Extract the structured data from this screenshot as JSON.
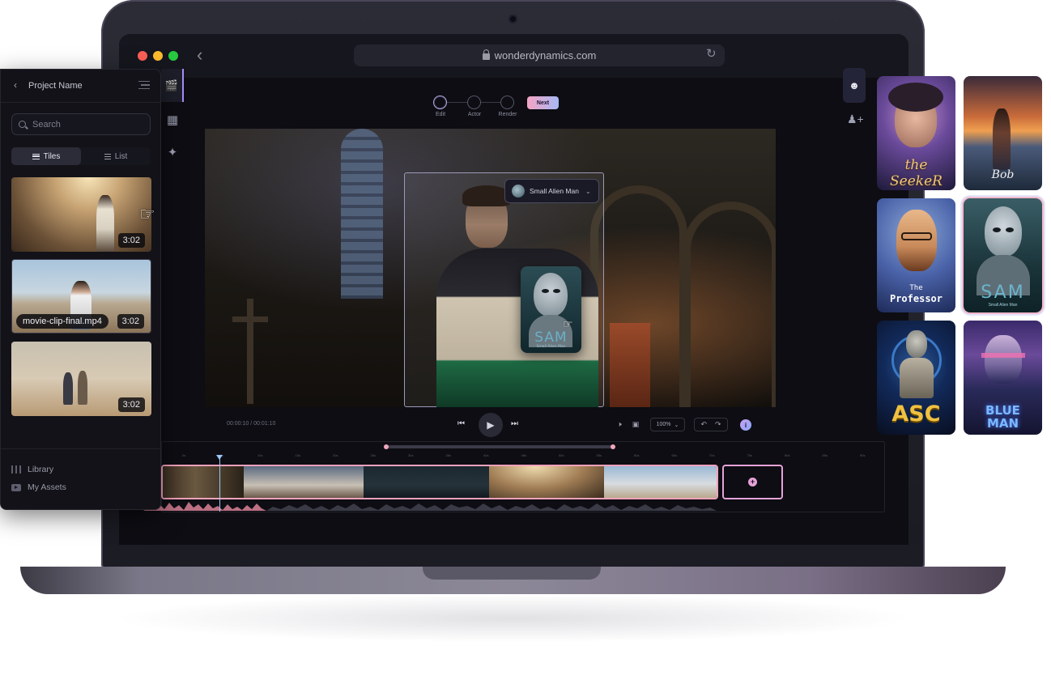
{
  "browser": {
    "url": "wonderdynamics.com"
  },
  "project_panel": {
    "title": "Project Name",
    "search_placeholder": "Search",
    "view_tabs": [
      {
        "label": "Tiles",
        "active": true
      },
      {
        "label": "List",
        "active": false
      }
    ],
    "clips": [
      {
        "duration": "3:02"
      },
      {
        "duration": "3:02",
        "filename": "movie-clip-final.mp4"
      },
      {
        "duration": "3:02"
      }
    ],
    "nav": [
      {
        "label": "Library",
        "icon": "library-icon"
      },
      {
        "label": "My Assets",
        "icon": "assets-icon"
      }
    ]
  },
  "stepper": {
    "steps": [
      {
        "label": "Edit",
        "active": true
      },
      {
        "label": "Actor",
        "active": false
      },
      {
        "label": "Render",
        "active": false
      }
    ],
    "next_label": "Next"
  },
  "viewer": {
    "actor_selector": {
      "selected": "Small Alien Man"
    },
    "drag_card": {
      "name": "SAM",
      "subtitle": "Small Alien Man"
    }
  },
  "transport": {
    "current_time": "00:00:10",
    "separator": "/",
    "total_time": "00:01:10",
    "zoom": "100%"
  },
  "timeline": {
    "ruler_labels": [
      "0s",
      "5s",
      "10s",
      "15s",
      "20s",
      "25s",
      "30s",
      "35s",
      "40s",
      "45s",
      "50s",
      "55s",
      "60s",
      "65s",
      "70s",
      "75s",
      "80s",
      "85s",
      "90s"
    ]
  },
  "characters": [
    {
      "name": "the SeekeR",
      "subtitle": ""
    },
    {
      "name": "Bob",
      "subtitle": ""
    },
    {
      "name": "The",
      "subtitle": "Professor"
    },
    {
      "name": "SAM",
      "subtitle": "Small Alien Man",
      "selected": true
    },
    {
      "name": "ASC",
      "subtitle": ""
    },
    {
      "name": "BLUE",
      "subtitle": "MAN"
    }
  ]
}
